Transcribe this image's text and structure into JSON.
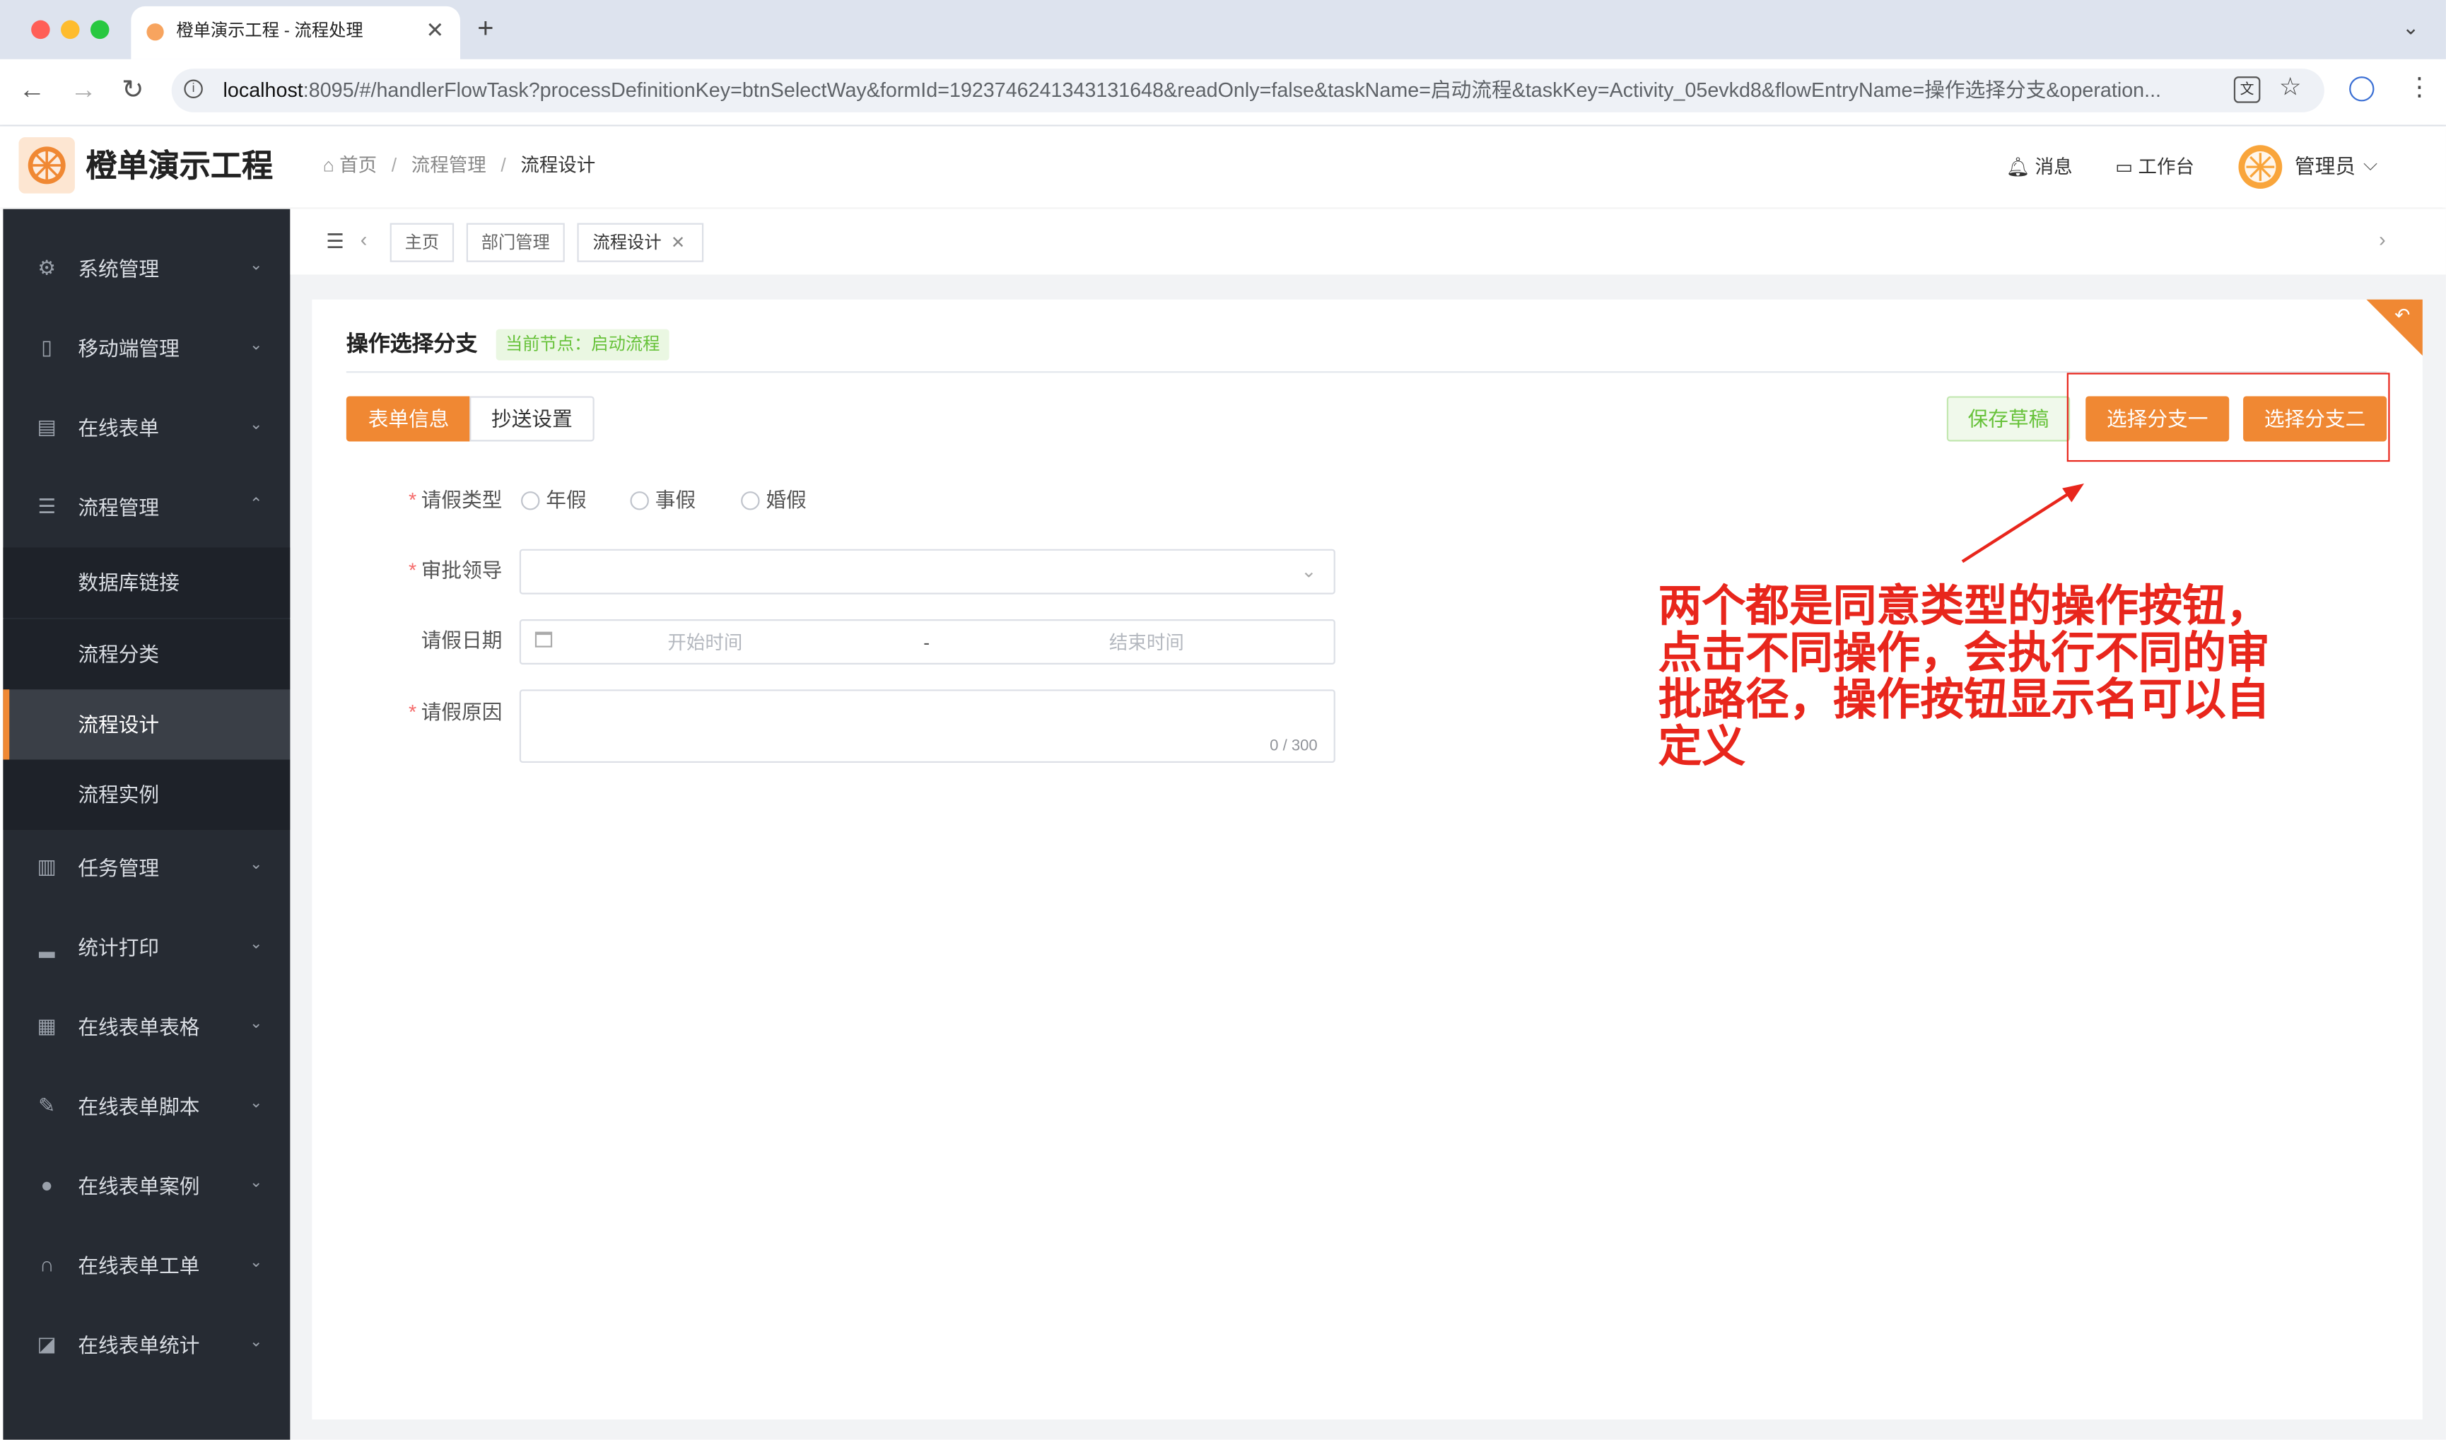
{
  "browser": {
    "tab_title": "橙单演示工程 - 流程处理",
    "new_tab": "+",
    "url_host": "localhost",
    "url_rest": ":8095/#/handlerFlowTask?processDefinitionKey=btnSelectWay&formId=1923746241343131648&readOnly=false&taskName=启动流程&taskKey=Activity_05evkd8&flowEntryName=操作选择分支&operation..."
  },
  "app": {
    "title": "橙单演示工程",
    "breadcrumb": [
      "首页",
      "流程管理",
      "流程设计"
    ],
    "breadcrumb_sep": "/",
    "header_actions": {
      "messages": "消息",
      "workbench": "工作台",
      "user": "管理员"
    }
  },
  "sidebar": {
    "items": [
      {
        "label": "系统管理",
        "icon": "gear-icon"
      },
      {
        "label": "移动端管理",
        "icon": "mobile-icon"
      },
      {
        "label": "在线表单",
        "icon": "form-icon"
      },
      {
        "label": "流程管理",
        "icon": "sliders-icon"
      },
      {
        "label": "任务管理",
        "icon": "document-icon"
      },
      {
        "label": "统计打印",
        "icon": "bar-chart-icon"
      },
      {
        "label": "在线表单表格",
        "icon": "grid-icon"
      },
      {
        "label": "在线表单脚本",
        "icon": "pen-icon"
      },
      {
        "label": "在线表单案例",
        "icon": "user-icon"
      },
      {
        "label": "在线表单工单",
        "icon": "headset-icon"
      },
      {
        "label": "在线表单统计",
        "icon": "line-chart-icon"
      }
    ],
    "sub_items": [
      "数据库链接",
      "流程分类",
      "流程设计",
      "流程实例"
    ]
  },
  "tags": [
    "主页",
    "部门管理",
    "流程设计"
  ],
  "form": {
    "title": "操作选择分支",
    "current_node": "当前节点：启动流程",
    "tabs": [
      "表单信息",
      "抄送设置"
    ],
    "buttons": {
      "save_draft": "保存草稿",
      "branch_one": "选择分支一",
      "branch_two": "选择分支二"
    },
    "fields": {
      "leave_type": {
        "label": "请假类型",
        "options": [
          "年假",
          "事假",
          "婚假"
        ]
      },
      "approver": {
        "label": "审批领导",
        "value": ""
      },
      "leave_date": {
        "label": "请假日期",
        "start_placeholder": "开始时间",
        "separator": "-",
        "end_placeholder": "结束时间"
      },
      "reason": {
        "label": "请假原因",
        "counter": "0 / 300"
      }
    }
  },
  "annotation": {
    "text": "两个都是同意类型的操作按钮，点击不同操作，会执行不同的审批路径，操作按钮显示名可以自定义",
    "color": "#e8261c"
  },
  "colors": {
    "accent": "#f08833",
    "sidebar_bg": "#262b33",
    "success_tag": "#67c23a"
  }
}
